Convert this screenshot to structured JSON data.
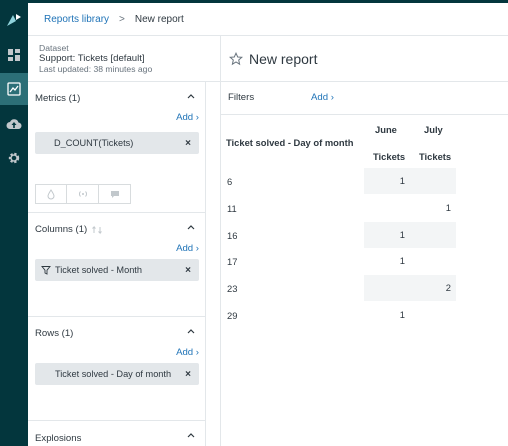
{
  "nav": {
    "items": [
      {
        "name": "logo-icon"
      },
      {
        "name": "dashboards-icon"
      },
      {
        "name": "reports-icon",
        "active": true
      },
      {
        "name": "upload-icon"
      },
      {
        "name": "gear-icon"
      }
    ]
  },
  "breadcrumb": {
    "library": "Reports library",
    "separator": ">",
    "current": "New report"
  },
  "dataset": {
    "label": "Dataset",
    "name": "Support: Tickets [default]",
    "updated": "Last updated: 38 minutes ago"
  },
  "report": {
    "title": "New report"
  },
  "metrics": {
    "title": "Metrics (1)",
    "add": "Add ›",
    "pill": "D_COUNT(Tickets)",
    "remove": "×"
  },
  "columns": {
    "title": "Columns (1)",
    "add": "Add ›",
    "pill": "Ticket solved - Month",
    "remove": "×"
  },
  "rows": {
    "title": "Rows (1)",
    "add": "Add ›",
    "pill": "Ticket solved - Day of month",
    "remove": "×"
  },
  "explosions": {
    "title": "Explosions"
  },
  "filters": {
    "label": "Filters",
    "add": "Add ›"
  },
  "table": {
    "row_header": "Ticket solved - Day of month",
    "columns": [
      "June",
      "July"
    ],
    "metric_header": "Tickets",
    "rows": [
      {
        "label": "6",
        "values": [
          "1",
          ""
        ]
      },
      {
        "label": "11",
        "values": [
          "",
          "1"
        ]
      },
      {
        "label": "16",
        "values": [
          "1",
          ""
        ]
      },
      {
        "label": "17",
        "values": [
          "1",
          ""
        ]
      },
      {
        "label": "23",
        "values": [
          "",
          "2"
        ]
      },
      {
        "label": "29",
        "values": [
          "1",
          ""
        ]
      }
    ]
  }
}
